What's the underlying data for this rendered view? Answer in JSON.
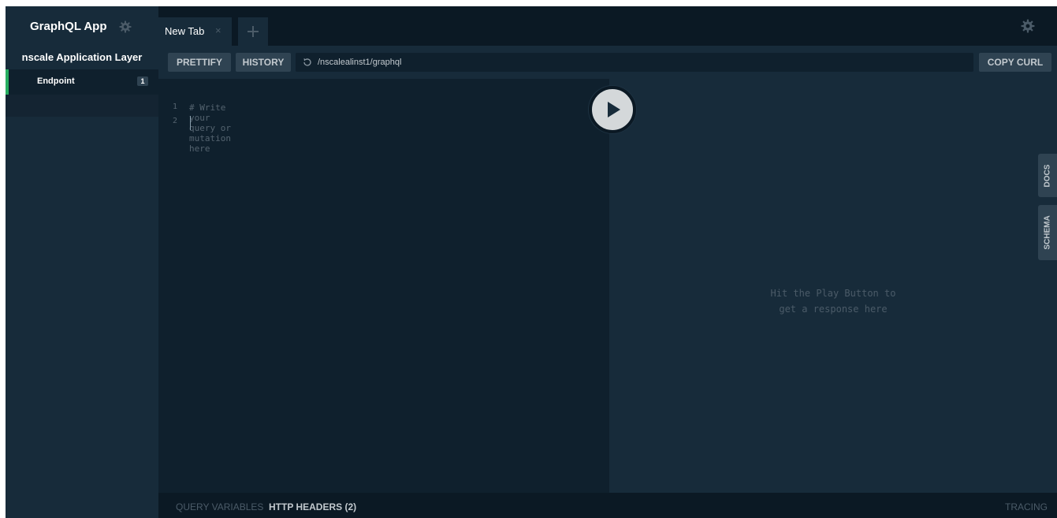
{
  "sidebar": {
    "app_title": "GraphQL App",
    "project_title": "nscale Application Layer",
    "endpoint": {
      "label": "Endpoint",
      "count": "1"
    }
  },
  "tabs": [
    {
      "label": "New Tab",
      "close": "×"
    }
  ],
  "new_tab_symbol": "+",
  "toolbar": {
    "prettify_label": "PRETTIFY",
    "history_label": "HISTORY",
    "url": "/nscalealinst1/graphql",
    "copy_curl_label": "COPY CURL"
  },
  "editor": {
    "lines": [
      {
        "number": "1",
        "text": "# Write your query or mutation here"
      },
      {
        "number": "2",
        "text": ""
      }
    ]
  },
  "result": {
    "hint": "Hit the Play Button to\nget a response here"
  },
  "side_tabs": {
    "docs_label": "DOCS",
    "schema_label": "SCHEMA"
  },
  "bottom_bar": {
    "query_variables_label": "QUERY VARIABLES",
    "http_headers_label": "HTTP HEADERS (2)",
    "tracing_label": "TRACING"
  },
  "colors": {
    "sidebar_bg": "#172b3a",
    "editor_bg": "#0f202d",
    "tabbar_bg": "#0b1924",
    "accent_green": "#27ae60",
    "button_bg": "#2f4352"
  },
  "icons": {
    "app_settings": "gear-icon",
    "global_settings": "gear-icon",
    "url_reload": "reload-icon",
    "run": "play-icon"
  }
}
